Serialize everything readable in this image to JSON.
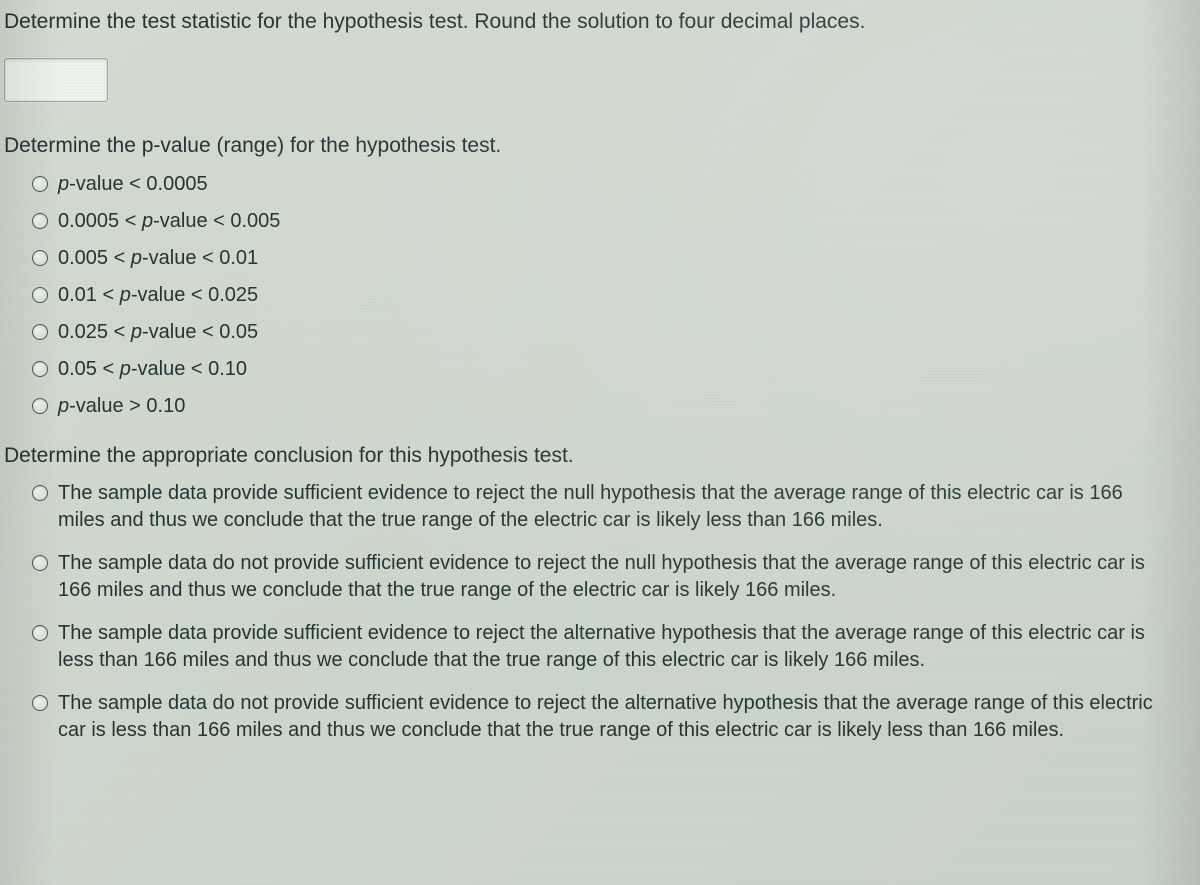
{
  "q1": {
    "prompt": "Determine the test statistic for the hypothesis test. Round the solution to four decimal places.",
    "input_value": ""
  },
  "q2": {
    "prompt_html": "Determine the <span class=\"ital\">p</span>-value (range) for the hypothesis test.",
    "options": [
      "<span class=\"ital\">p</span>-value &lt; 0.0005",
      "0.0005 &lt; <span class=\"ital\">p</span>-value &lt; 0.005",
      "0.005 &lt; <span class=\"ital\">p</span>-value &lt; 0.01",
      "0.01 &lt; <span class=\"ital\">p</span>-value &lt; 0.025",
      "0.025 &lt; <span class=\"ital\">p</span>-value &lt; 0.05",
      "0.05 &lt; <span class=\"ital\">p</span>-value &lt; 0.10",
      "<span class=\"ital\">p</span>-value &gt; 0.10"
    ]
  },
  "q3": {
    "prompt": "Determine the appropriate conclusion for this hypothesis test.",
    "options": [
      "The sample data provide sufficient evidence to reject the null hypothesis that the average range of this electric car is 166 miles and thus we conclude that the true range of the electric car is likely less than 166 miles.",
      "The sample data do not provide sufficient evidence to reject the null hypothesis that the average range of this electric car is 166 miles and thus we conclude that the true range of the electric car is likely 166 miles.",
      "The sample data provide sufficient evidence to reject the alternative hypothesis that the average range of this electric car is less than 166 miles and thus we conclude that the true range of this electric car is likely 166 miles.",
      "The sample data do not provide sufficient evidence to reject the alternative hypothesis that the average range of this electric car is less than 166 miles and thus we conclude that the true range of this electric car is likely less than 166 miles."
    ]
  }
}
